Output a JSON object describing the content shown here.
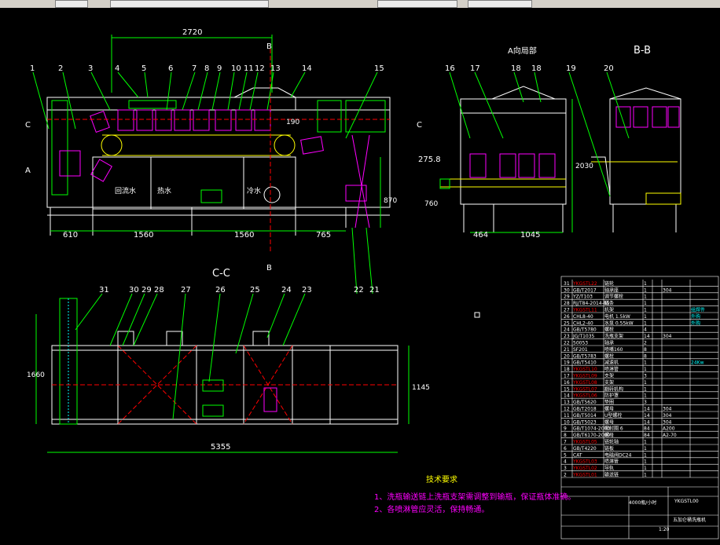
{
  "view_labels": {
    "top_dim": "2720",
    "section_b_top": "B",
    "section_b_bottom": "B",
    "section_c_left": "C",
    "section_c_right": "C",
    "section_a_left": "A",
    "a_view": "A向局部",
    "bb_title": "B-B",
    "cc_title": "C-C"
  },
  "balloons_top": [
    "1",
    "2",
    "3",
    "4",
    "5",
    "6",
    "7",
    "8",
    "9",
    "10",
    "11",
    "12",
    "13",
    "14",
    "15"
  ],
  "balloons_right": [
    "16",
    "17",
    "18",
    "18",
    "19",
    "20"
  ],
  "balloons_bottom": [
    "31",
    "30",
    "29",
    "28",
    "27",
    "26",
    "25",
    "24",
    "23",
    "22",
    "21"
  ],
  "dims": {
    "d610": "610",
    "d1560a": "1560",
    "d1560b": "1560",
    "d765": "765",
    "d870": "870",
    "d190": "190",
    "d2758": "275.8",
    "d760": "760",
    "d2030": "2030",
    "d464": "464",
    "d1045": "1045",
    "d1660": "1660",
    "d1145": "1145",
    "d5355": "5355"
  },
  "tank_labels": [
    "回流水",
    "热水",
    "冷水"
  ],
  "tech_notes": {
    "title": "技术要求",
    "line1": "1、洗瓶输送链上洗瓶支架需调整到输瓶，保证瓶体准确。",
    "line2": "2、各喷淋管应灵活，保持畅通。"
  },
  "bom_rows": [
    [
      "31",
      "YKGSTL22",
      "链轮",
      "1",
      "",
      "",
      ""
    ],
    [
      "30",
      "GB/T2017",
      "轴承座",
      "1",
      "",
      "304",
      ""
    ],
    [
      "29",
      "YZ/T103",
      "调节螺栓",
      "1",
      "",
      "",
      ""
    ],
    [
      "28",
      "RJ/T84-2014-85",
      "链条",
      "1",
      "",
      "",
      ""
    ],
    [
      "27",
      "YKGSTL11",
      "机架",
      "1",
      "",
      "",
      "组焊件"
    ],
    [
      "26",
      "CHL8-40",
      "电机 1.5kW",
      "1",
      "",
      "",
      "外购"
    ],
    [
      "25",
      "CHL2-40",
      "水泵 0.55kW",
      "1",
      "",
      "",
      "外购"
    ],
    [
      "24",
      "GB/T5780",
      "螺栓",
      "4",
      "",
      "",
      ""
    ],
    [
      "23",
      "JG/T1035",
      "洗瓶支架",
      "14",
      "",
      "304",
      ""
    ],
    [
      "22",
      "50053",
      "轴承",
      "2",
      "",
      "",
      ""
    ],
    [
      "21",
      "SF201",
      "喷嘴160",
      "8",
      "",
      "",
      ""
    ],
    [
      "20",
      "GB/T5783",
      "螺栓",
      "8",
      "",
      "",
      ""
    ],
    [
      "19",
      "GB/T5410",
      "减速机",
      "1",
      "",
      "",
      "24Kw"
    ],
    [
      "18",
      "YKGSTL10",
      "喷淋管",
      "1",
      "",
      "",
      ""
    ],
    [
      "17",
      "YKGSTL09",
      "支架",
      "3",
      "",
      "",
      ""
    ],
    [
      "16",
      "YKGSTL08",
      "支架",
      "1",
      "",
      "",
      ""
    ],
    [
      "15",
      "YKGSTL07",
      "翻转机构",
      "1",
      "",
      "",
      ""
    ],
    [
      "14",
      "YKGSTL06",
      "防护罩",
      "1",
      "",
      "",
      ""
    ],
    [
      "13",
      "GB/T5620",
      "垫圈",
      "3",
      "",
      "",
      ""
    ],
    [
      "12",
      "GB/T2018",
      "螺母",
      "14",
      "",
      "304",
      ""
    ],
    [
      "11",
      "GB/T5014",
      "U型螺栓",
      "14",
      "",
      "304",
      ""
    ],
    [
      "10",
      "GB/T5023",
      "螺母",
      "14",
      "",
      "304",
      ""
    ],
    [
      "9",
      "GB/T1074-2000",
      "密封圈 6",
      "84",
      "",
      "A200",
      ""
    ],
    [
      "8",
      "GB/T6170-2000",
      "螺母",
      "84",
      "",
      "A2-70",
      ""
    ],
    [
      "7",
      "YKGSTL05",
      "链轮轴",
      "1",
      "",
      "",
      ""
    ],
    [
      "6",
      "GB/T4220",
      "链板",
      "1",
      "",
      "",
      ""
    ],
    [
      "5",
      "CAT",
      "电磁阀DC24",
      "1",
      "",
      "",
      ""
    ],
    [
      "4",
      "YKGSTL03",
      "喷淋管",
      "1",
      "",
      "",
      ""
    ],
    [
      "3",
      "YKGSTL02",
      "导轨",
      "1",
      "",
      "",
      ""
    ],
    [
      "2",
      "YKGSTL01",
      "输送链",
      "1",
      "",
      "",
      ""
    ]
  ],
  "title_block": {
    "drawing_no": "YKGSTL00",
    "name": "4000瓶/小时",
    "product": "五加仑桶洗瓶机",
    "scale": "1:20"
  }
}
